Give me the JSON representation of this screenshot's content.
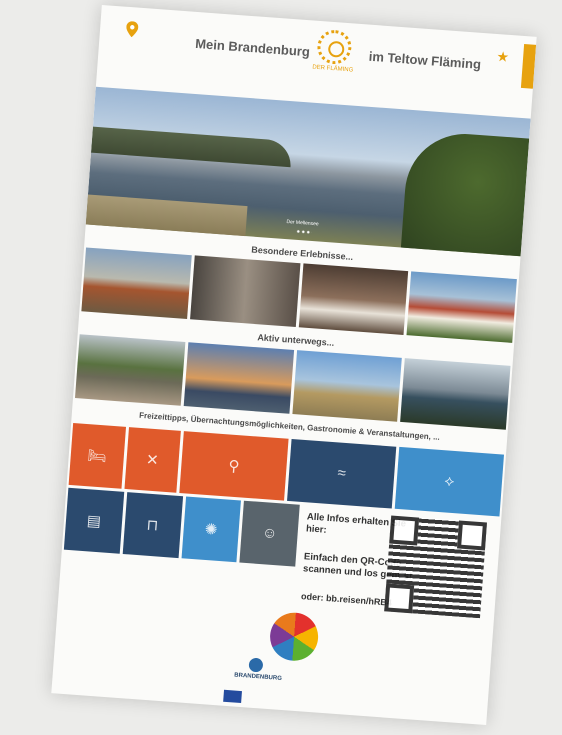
{
  "header": {
    "left_title": "Mein Brandenburg",
    "right_title": "im Teltow Fläming",
    "logo_caption": "DER FLÄMING",
    "location_icon": "map-pin-icon",
    "favorite_icon": "star-icon"
  },
  "hero": {
    "caption": "Der Mellensee"
  },
  "sections": {
    "experiences_title": "Besondere Erlebnisse...",
    "active_title": "Aktiv unterwegs...",
    "tips_title": "Freizeittipps, Übernachtungsmöglichkeiten, Gastronomie & Veranstaltungen, ..."
  },
  "experiences": [
    {
      "caption": ""
    },
    {
      "caption": ""
    },
    {
      "caption": ""
    },
    {
      "caption": ""
    }
  ],
  "active": [
    {
      "caption": ""
    },
    {
      "caption": ""
    },
    {
      "caption": ""
    },
    {
      "caption": ""
    }
  ],
  "tiles_row1": [
    {
      "icon": "bed-icon",
      "color": "#e05a2b"
    },
    {
      "icon": "fork-knife-icon",
      "color": "#e05a2b"
    },
    {
      "icon": "bicycle-icon",
      "color": "#e05a2b"
    },
    {
      "icon": "water-icon",
      "color": "#2b4a6e"
    },
    {
      "icon": "route-icon",
      "color": "#3f8fcb"
    }
  ],
  "tiles_row2": [
    {
      "icon": "calendar-icon",
      "color": "#2b4a6e"
    },
    {
      "icon": "shopping-bag-icon",
      "color": "#2b4a6e"
    },
    {
      "icon": "ferris-wheel-icon",
      "color": "#3f8fcb"
    },
    {
      "icon": "theater-masks-icon",
      "color": "#59646c"
    }
  ],
  "info": {
    "line1": "Alle Infos erhalten Sie hier:",
    "line2": "Einfach den QR-Code scannen und los geht´s!",
    "url_prefix": "oder:",
    "url": "bb.reisen/hRB4"
  },
  "footer": {
    "brand": "BRANDENBURG"
  },
  "colors": {
    "accent_orange": "#e7a20f",
    "tile_orange": "#e05a2b",
    "tile_navy": "#2b4a6e",
    "tile_lightblue": "#3f8fcb",
    "tile_slate": "#59646c"
  }
}
